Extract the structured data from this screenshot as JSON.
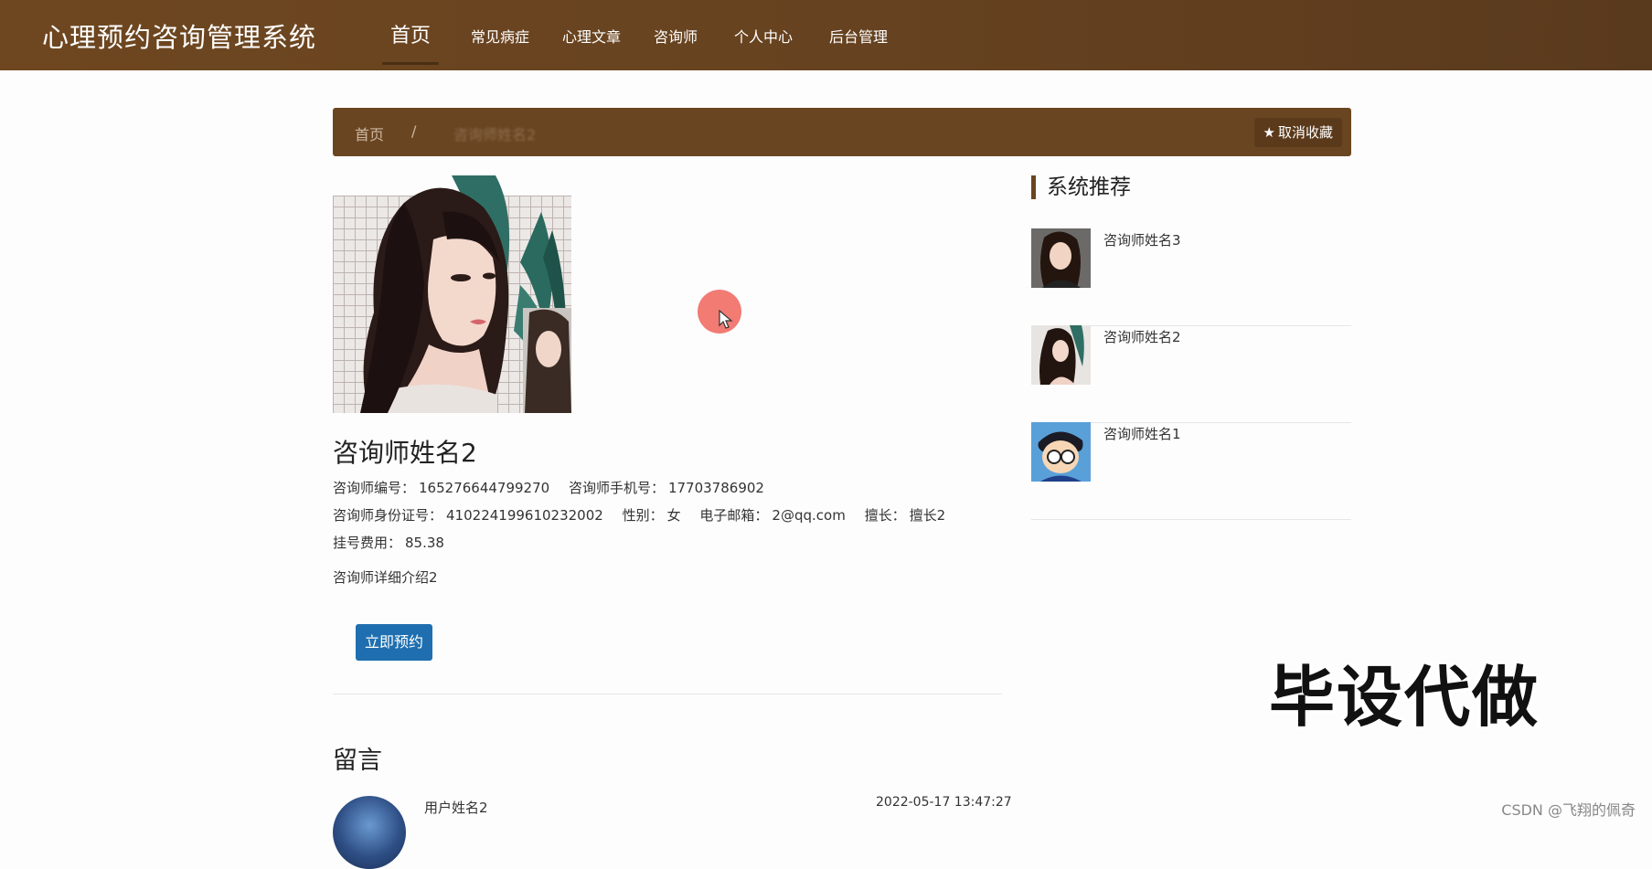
{
  "header": {
    "site_title": "心理预约咨询管理系统",
    "nav": [
      "首页",
      "常见病症",
      "心理文章",
      "咨询师",
      "个人中心",
      "后台管理"
    ]
  },
  "breadcrumb": {
    "home": "首页",
    "separator": "/",
    "current": "咨询师姓名2"
  },
  "favorite_button": {
    "icon": "star-icon",
    "label": "取消收藏"
  },
  "consultant": {
    "name": "咨询师姓名2",
    "id_label": "咨询师编号：",
    "id_value": "165276644799270",
    "phone_label": "咨询师手机号：",
    "phone_value": "17703786902",
    "idcard_label": "咨询师身份证号：",
    "idcard_value": "410224199610232002",
    "gender_label": "性别：",
    "gender_value": "女",
    "email_label": "电子邮箱：",
    "email_value": "2@qq.com",
    "specialty_label": "擅长：",
    "specialty_value": "擅长2",
    "fee_label": "挂号费用：",
    "fee_value": "85.38",
    "intro": "咨询师详细介绍2",
    "book_label": "立即预约"
  },
  "messages": {
    "title": "留言",
    "items": [
      {
        "user": "用户姓名2",
        "time": "2022-05-17 13:47:27"
      }
    ]
  },
  "sidebar": {
    "title": "系统推荐",
    "items": [
      {
        "name": "咨询师姓名3"
      },
      {
        "name": "咨询师姓名2"
      },
      {
        "name": "咨询师姓名1"
      }
    ]
  },
  "overlay": {
    "watermark": "毕设代做",
    "credit": "CSDN @飞翔的佩奇"
  },
  "colors": {
    "nav_bg": "#6a4521",
    "button": "#1f6fb0"
  }
}
